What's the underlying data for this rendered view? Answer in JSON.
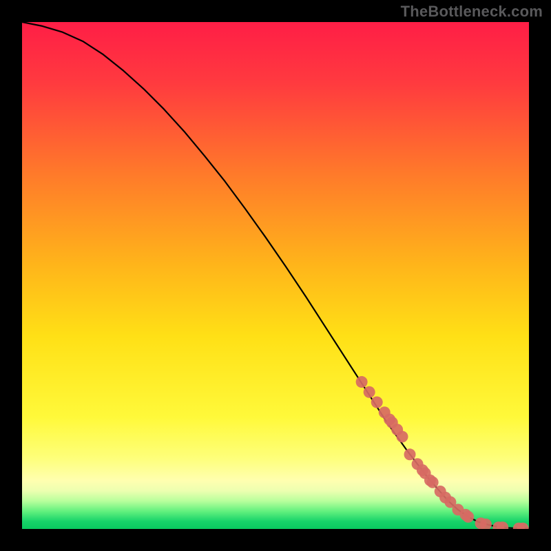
{
  "attribution": "TheBottleneck.com",
  "colors": {
    "background_black": "#000000",
    "curve": "#000000",
    "marker_fill": "#d76a63",
    "marker_outline": "#d76a63"
  },
  "chart_data": {
    "type": "line",
    "title": "",
    "xlabel": "",
    "ylabel": "",
    "xlim": [
      0,
      100
    ],
    "ylim": [
      0,
      100
    ],
    "grid": false,
    "curve": {
      "x": [
        0,
        4,
        8,
        12,
        16,
        20,
        24,
        28,
        32,
        36,
        40,
        44,
        48,
        52,
        56,
        60,
        64,
        68,
        72,
        76,
        80,
        84,
        86,
        88,
        90,
        92,
        94,
        96,
        98,
        100
      ],
      "y": [
        100,
        99.2,
        98.0,
        96.2,
        93.6,
        90.4,
        86.8,
        82.8,
        78.4,
        73.6,
        68.6,
        63.2,
        57.6,
        51.8,
        45.8,
        39.6,
        33.4,
        27.2,
        21.0,
        15.4,
        10.2,
        5.6,
        3.8,
        2.4,
        1.4,
        0.8,
        0.4,
        0.2,
        0.1,
        0.1
      ]
    },
    "markers": {
      "x": [
        67,
        68.5,
        70,
        71.5,
        72.5,
        73,
        74,
        75,
        76.5,
        78,
        79,
        79.5,
        80.5,
        81,
        82.5,
        83.5,
        84.5,
        86,
        87.5,
        88,
        90.5,
        91.5,
        94,
        94.8,
        98,
        98.8
      ],
      "y": [
        29.0,
        27.0,
        25.0,
        23.0,
        21.6,
        21.0,
        19.6,
        18.2,
        14.7,
        12.8,
        11.6,
        11.0,
        9.6,
        9.2,
        7.4,
        6.2,
        5.3,
        3.8,
        2.8,
        2.4,
        1.1,
        0.9,
        0.3,
        0.3,
        0.1,
        0.1
      ]
    }
  }
}
